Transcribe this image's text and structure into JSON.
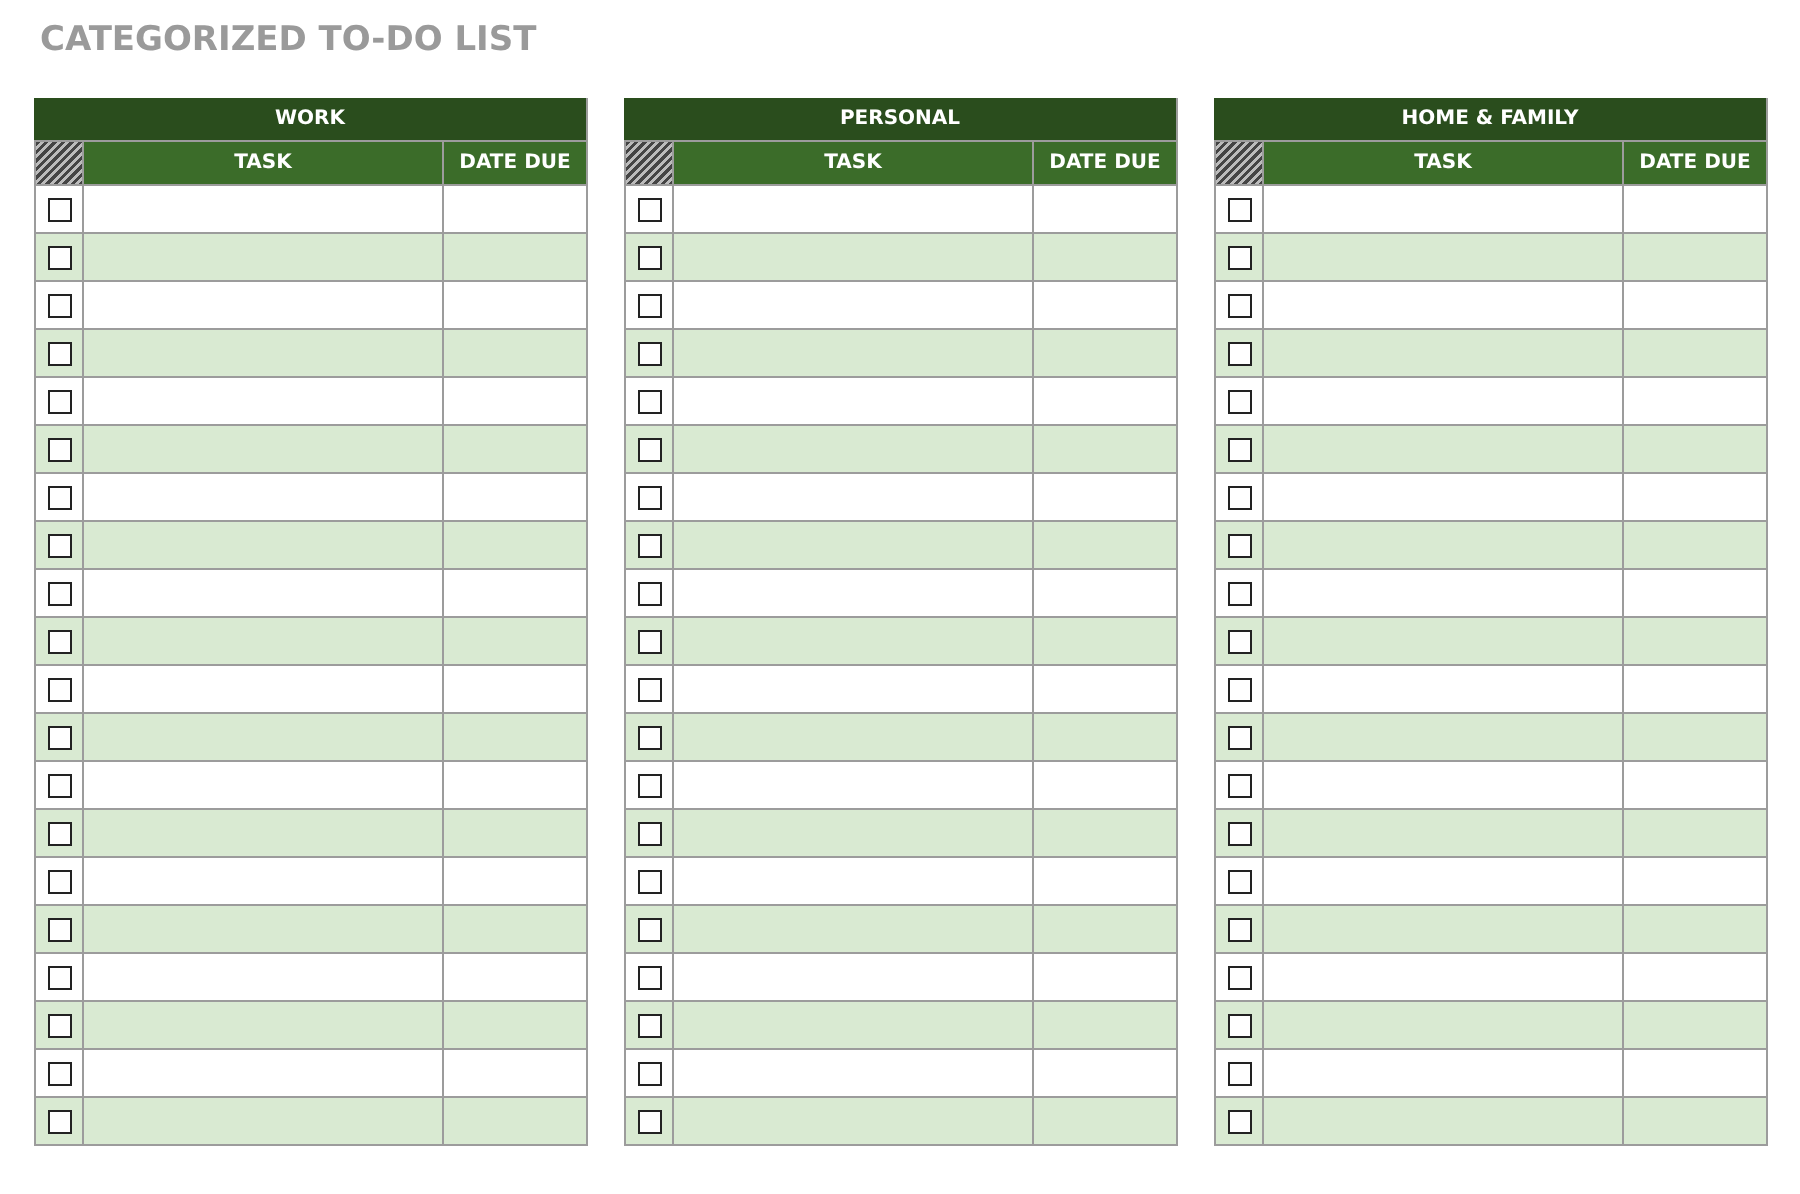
{
  "title": "CATEGORIZED TO-DO LIST",
  "tables": [
    {
      "category": "WORK",
      "columns": [
        "TASK",
        "DATE DUE"
      ],
      "rows": [
        {
          "checked": false
        },
        {
          "checked": false
        },
        {
          "checked": false
        },
        {
          "checked": false
        },
        {
          "checked": false
        },
        {
          "checked": false
        },
        {
          "checked": false
        },
        {
          "checked": false
        },
        {
          "checked": false
        },
        {
          "checked": false
        },
        {
          "checked": false
        },
        {
          "checked": false
        },
        {
          "checked": false
        },
        {
          "checked": false
        },
        {
          "checked": false
        },
        {
          "checked": false
        },
        {
          "checked": false
        },
        {
          "checked": false
        },
        {
          "checked": false
        },
        {
          "checked": false
        }
      ]
    },
    {
      "category": "PERSONAL",
      "columns": [
        "TASK",
        "DATE DUE"
      ],
      "rows": [
        {
          "checked": false
        },
        {
          "checked": false
        },
        {
          "checked": false
        },
        {
          "checked": false
        },
        {
          "checked": false
        },
        {
          "checked": false
        },
        {
          "checked": false
        },
        {
          "checked": false
        },
        {
          "checked": false
        },
        {
          "checked": false
        },
        {
          "checked": false
        },
        {
          "checked": false
        },
        {
          "checked": false
        },
        {
          "checked": false
        },
        {
          "checked": false
        },
        {
          "checked": false
        },
        {
          "checked": false
        },
        {
          "checked": false
        },
        {
          "checked": false
        },
        {
          "checked": false
        }
      ]
    },
    {
      "category": "HOME & FAMILY",
      "columns": [
        "TASK",
        "DATE DUE"
      ],
      "rows": [
        {
          "checked": false
        },
        {
          "checked": false
        },
        {
          "checked": false
        },
        {
          "checked": false
        },
        {
          "checked": false
        },
        {
          "checked": false
        },
        {
          "checked": false
        },
        {
          "checked": false
        },
        {
          "checked": false
        },
        {
          "checked": false
        },
        {
          "checked": false
        },
        {
          "checked": false
        },
        {
          "checked": false
        },
        {
          "checked": false
        },
        {
          "checked": false
        },
        {
          "checked": false
        },
        {
          "checked": false
        },
        {
          "checked": false
        },
        {
          "checked": false
        },
        {
          "checked": false
        }
      ]
    }
  ]
}
